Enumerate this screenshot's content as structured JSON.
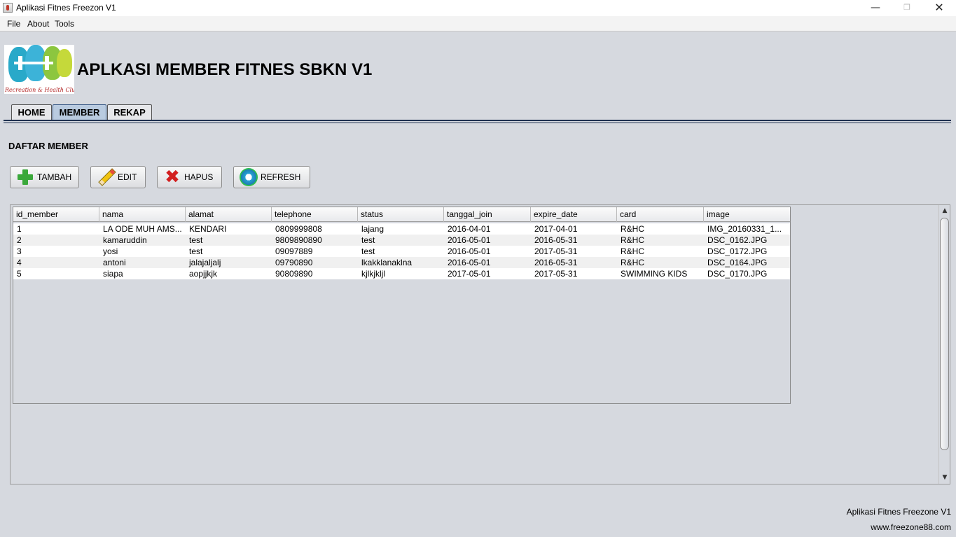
{
  "window": {
    "title": "Aplikasi Fitnes Freezon V1"
  },
  "menu": {
    "items": [
      "File",
      "About",
      "Tools"
    ]
  },
  "logo": {
    "caption": "Recreation & Health Club"
  },
  "header": {
    "title": "APLKASI MEMBER FITNES SBKN V1"
  },
  "tabs": {
    "items": [
      "HOME",
      "MEMBER",
      "REKAP"
    ],
    "active": "MEMBER"
  },
  "section": {
    "title": "DAFTAR MEMBER"
  },
  "toolbar": {
    "add_label": "TAMBAH",
    "edit_label": "EDIT",
    "delete_label": "HAPUS",
    "refresh_label": "REFRESH"
  },
  "table": {
    "columns": [
      "id_member",
      "nama",
      "alamat",
      "telephone",
      "status",
      "tanggal_join",
      "expire_date",
      "card",
      "image"
    ],
    "rows": [
      [
        "1",
        "LA ODE MUH AMS...",
        "KENDARI",
        "0809999808",
        "lajang",
        "2016-04-01",
        "2017-04-01",
        "R&HC",
        "IMG_20160331_1..."
      ],
      [
        "2",
        "kamaruddin",
        "test",
        "9809890890",
        "test",
        "2016-05-01",
        "2016-05-31",
        "R&HC",
        "DSC_0162.JPG"
      ],
      [
        "3",
        "yosi",
        "test",
        "09097889",
        "test",
        "2016-05-01",
        "2017-05-31",
        "R&HC",
        "DSC_0172.JPG"
      ],
      [
        "4",
        "antoni",
        "jalajaljalj",
        "09790890",
        "lkakklanaklna",
        "2016-05-01",
        "2016-05-31",
        "R&HC",
        "DSC_0164.JPG"
      ],
      [
        "5",
        "siapa",
        "aopjjkjk",
        "90809890",
        "kjlkjkljl",
        "2017-05-01",
        "2017-05-31",
        "SWIMMING KIDS",
        "DSC_0170.JPG"
      ]
    ]
  },
  "footer": {
    "app_name": "Aplikasi Fitnes Freezone V1",
    "website": "www.freezone88.com"
  },
  "colors": {
    "window_bg": "#d6d9df",
    "active_tab": "#b9cbe0",
    "tab_line": "#1f3150",
    "add_icon": "#3aa83a",
    "delete_icon": "#d21f1f"
  },
  "icons": [
    "java-app-icon",
    "club-logo",
    "plus-icon",
    "pencil-icon",
    "x-icon",
    "refresh-icon"
  ]
}
